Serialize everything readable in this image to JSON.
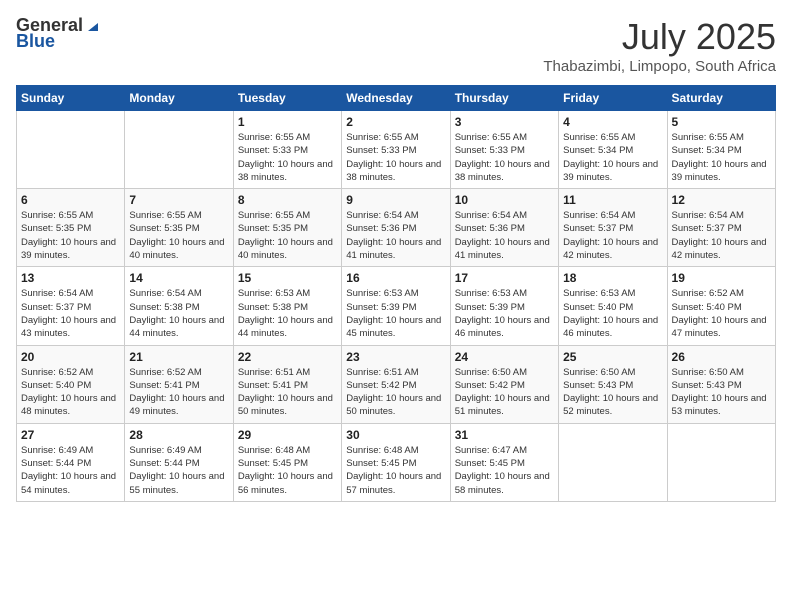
{
  "logo": {
    "general": "General",
    "blue": "Blue"
  },
  "title": {
    "month_year": "July 2025",
    "location": "Thabazimbi, Limpopo, South Africa"
  },
  "headers": [
    "Sunday",
    "Monday",
    "Tuesday",
    "Wednesday",
    "Thursday",
    "Friday",
    "Saturday"
  ],
  "weeks": [
    [
      {
        "day": "",
        "info": ""
      },
      {
        "day": "",
        "info": ""
      },
      {
        "day": "1",
        "info": "Sunrise: 6:55 AM\nSunset: 5:33 PM\nDaylight: 10 hours and 38 minutes."
      },
      {
        "day": "2",
        "info": "Sunrise: 6:55 AM\nSunset: 5:33 PM\nDaylight: 10 hours and 38 minutes."
      },
      {
        "day": "3",
        "info": "Sunrise: 6:55 AM\nSunset: 5:33 PM\nDaylight: 10 hours and 38 minutes."
      },
      {
        "day": "4",
        "info": "Sunrise: 6:55 AM\nSunset: 5:34 PM\nDaylight: 10 hours and 39 minutes."
      },
      {
        "day": "5",
        "info": "Sunrise: 6:55 AM\nSunset: 5:34 PM\nDaylight: 10 hours and 39 minutes."
      }
    ],
    [
      {
        "day": "6",
        "info": "Sunrise: 6:55 AM\nSunset: 5:35 PM\nDaylight: 10 hours and 39 minutes."
      },
      {
        "day": "7",
        "info": "Sunrise: 6:55 AM\nSunset: 5:35 PM\nDaylight: 10 hours and 40 minutes."
      },
      {
        "day": "8",
        "info": "Sunrise: 6:55 AM\nSunset: 5:35 PM\nDaylight: 10 hours and 40 minutes."
      },
      {
        "day": "9",
        "info": "Sunrise: 6:54 AM\nSunset: 5:36 PM\nDaylight: 10 hours and 41 minutes."
      },
      {
        "day": "10",
        "info": "Sunrise: 6:54 AM\nSunset: 5:36 PM\nDaylight: 10 hours and 41 minutes."
      },
      {
        "day": "11",
        "info": "Sunrise: 6:54 AM\nSunset: 5:37 PM\nDaylight: 10 hours and 42 minutes."
      },
      {
        "day": "12",
        "info": "Sunrise: 6:54 AM\nSunset: 5:37 PM\nDaylight: 10 hours and 42 minutes."
      }
    ],
    [
      {
        "day": "13",
        "info": "Sunrise: 6:54 AM\nSunset: 5:37 PM\nDaylight: 10 hours and 43 minutes."
      },
      {
        "day": "14",
        "info": "Sunrise: 6:54 AM\nSunset: 5:38 PM\nDaylight: 10 hours and 44 minutes."
      },
      {
        "day": "15",
        "info": "Sunrise: 6:53 AM\nSunset: 5:38 PM\nDaylight: 10 hours and 44 minutes."
      },
      {
        "day": "16",
        "info": "Sunrise: 6:53 AM\nSunset: 5:39 PM\nDaylight: 10 hours and 45 minutes."
      },
      {
        "day": "17",
        "info": "Sunrise: 6:53 AM\nSunset: 5:39 PM\nDaylight: 10 hours and 46 minutes."
      },
      {
        "day": "18",
        "info": "Sunrise: 6:53 AM\nSunset: 5:40 PM\nDaylight: 10 hours and 46 minutes."
      },
      {
        "day": "19",
        "info": "Sunrise: 6:52 AM\nSunset: 5:40 PM\nDaylight: 10 hours and 47 minutes."
      }
    ],
    [
      {
        "day": "20",
        "info": "Sunrise: 6:52 AM\nSunset: 5:40 PM\nDaylight: 10 hours and 48 minutes."
      },
      {
        "day": "21",
        "info": "Sunrise: 6:52 AM\nSunset: 5:41 PM\nDaylight: 10 hours and 49 minutes."
      },
      {
        "day": "22",
        "info": "Sunrise: 6:51 AM\nSunset: 5:41 PM\nDaylight: 10 hours and 50 minutes."
      },
      {
        "day": "23",
        "info": "Sunrise: 6:51 AM\nSunset: 5:42 PM\nDaylight: 10 hours and 50 minutes."
      },
      {
        "day": "24",
        "info": "Sunrise: 6:50 AM\nSunset: 5:42 PM\nDaylight: 10 hours and 51 minutes."
      },
      {
        "day": "25",
        "info": "Sunrise: 6:50 AM\nSunset: 5:43 PM\nDaylight: 10 hours and 52 minutes."
      },
      {
        "day": "26",
        "info": "Sunrise: 6:50 AM\nSunset: 5:43 PM\nDaylight: 10 hours and 53 minutes."
      }
    ],
    [
      {
        "day": "27",
        "info": "Sunrise: 6:49 AM\nSunset: 5:44 PM\nDaylight: 10 hours and 54 minutes."
      },
      {
        "day": "28",
        "info": "Sunrise: 6:49 AM\nSunset: 5:44 PM\nDaylight: 10 hours and 55 minutes."
      },
      {
        "day": "29",
        "info": "Sunrise: 6:48 AM\nSunset: 5:45 PM\nDaylight: 10 hours and 56 minutes."
      },
      {
        "day": "30",
        "info": "Sunrise: 6:48 AM\nSunset: 5:45 PM\nDaylight: 10 hours and 57 minutes."
      },
      {
        "day": "31",
        "info": "Sunrise: 6:47 AM\nSunset: 5:45 PM\nDaylight: 10 hours and 58 minutes."
      },
      {
        "day": "",
        "info": ""
      },
      {
        "day": "",
        "info": ""
      }
    ]
  ]
}
